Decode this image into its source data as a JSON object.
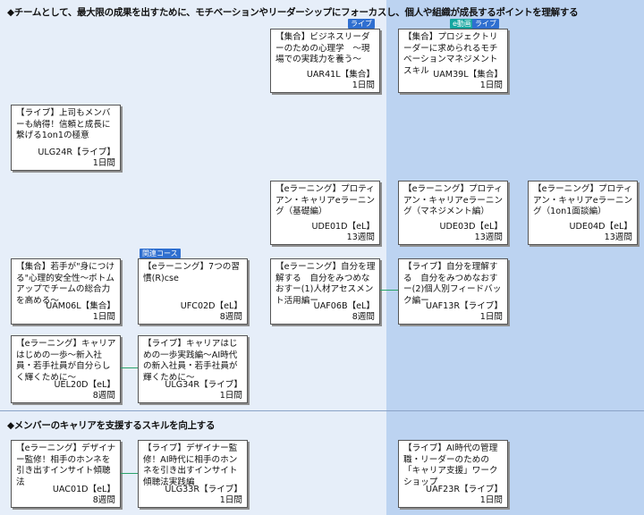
{
  "sections": [
    {
      "heading": "◆チームとして、最大限の成果を出すために、モチベーションやリーダーシップにフォーカスし、個人や組織が成長するポイントを理解する"
    },
    {
      "heading": "◆メンバーのキャリアを支援するスキルを向上する"
    }
  ],
  "tags": {
    "live": "ライブ",
    "video": "e動画",
    "kanren": "関連コース"
  },
  "cards": [
    {
      "title": "【集合】ビジネスリーダーのための心理学　～現場での実践力を養う～",
      "code": "UAR41L【集合】",
      "duration": "1日間"
    },
    {
      "title": "【集合】プロジェクトリーダーに求められるモチベーションマネジメントスキル",
      "code": "UAM39L【集合】",
      "duration": "1日間"
    },
    {
      "title": "【ライブ】上司もメンバーも納得！信頼と成長に繋げる1on1の極意",
      "code": "ULG24R【ライブ】",
      "duration": "1日間"
    },
    {
      "title": "【eラーニング】プロティアン・キャリアeラーニング（基礎編）",
      "code": "UDE01D【eL】",
      "duration": "13週間"
    },
    {
      "title": "【eラーニング】プロティアン・キャリアeラーニング（マネジメント編）",
      "code": "UDE03D【eL】",
      "duration": "13週間"
    },
    {
      "title": "【eラーニング】プロティアン・キャリアeラーニング（1on1面談編）",
      "code": "UDE04D【eL】",
      "duration": "13週間"
    },
    {
      "title": "【集合】若手が\"身につける\"心理的安全性～ボトムアップでチームの総合力を高める～",
      "code": "UAM06L【集合】",
      "duration": "1日間"
    },
    {
      "title": "【eラーニング】7つの習慣(R)cse",
      "code": "UFC02D【eL】",
      "duration": "8週間"
    },
    {
      "title": "【eラーニング】自分を理解する　自分をみつめなおすー(1)人材アセスメント活用編ー",
      "code": "UAF06B【eL】",
      "duration": "8週間"
    },
    {
      "title": "【ライブ】自分を理解する　自分をみつめなおすー(2)個人別フィードバック編ー",
      "code": "UAF13R【ライブ】",
      "duration": "1日間"
    },
    {
      "title": "【eラーニング】キャリアはじめの一歩～新入社員・若手社員が自分らしく輝くために～",
      "code": "UEL20D【eL】",
      "duration": "8週間"
    },
    {
      "title": "【ライブ】キャリアはじめの一歩実践編～AI時代の新入社員・若手社員が輝くために～",
      "code": "ULG34R【ライブ】",
      "duration": "1日間"
    },
    {
      "title": "【eラーニング】デザイナー監修！相手のホンネを引き出すインサイト傾聴法",
      "code": "UAC01D【eL】",
      "duration": "8週間"
    },
    {
      "title": "【ライブ】デザイナー監修！AI時代に相手のホンネを引き出すインサイト傾聴法実践編",
      "code": "ULG33R【ライブ】",
      "duration": "1日間"
    },
    {
      "title": "【ライブ】AI時代の管理職・リーダーのための「キャリア支援」ワークショップ",
      "code": "UAF23R【ライブ】",
      "duration": "1日間"
    }
  ]
}
